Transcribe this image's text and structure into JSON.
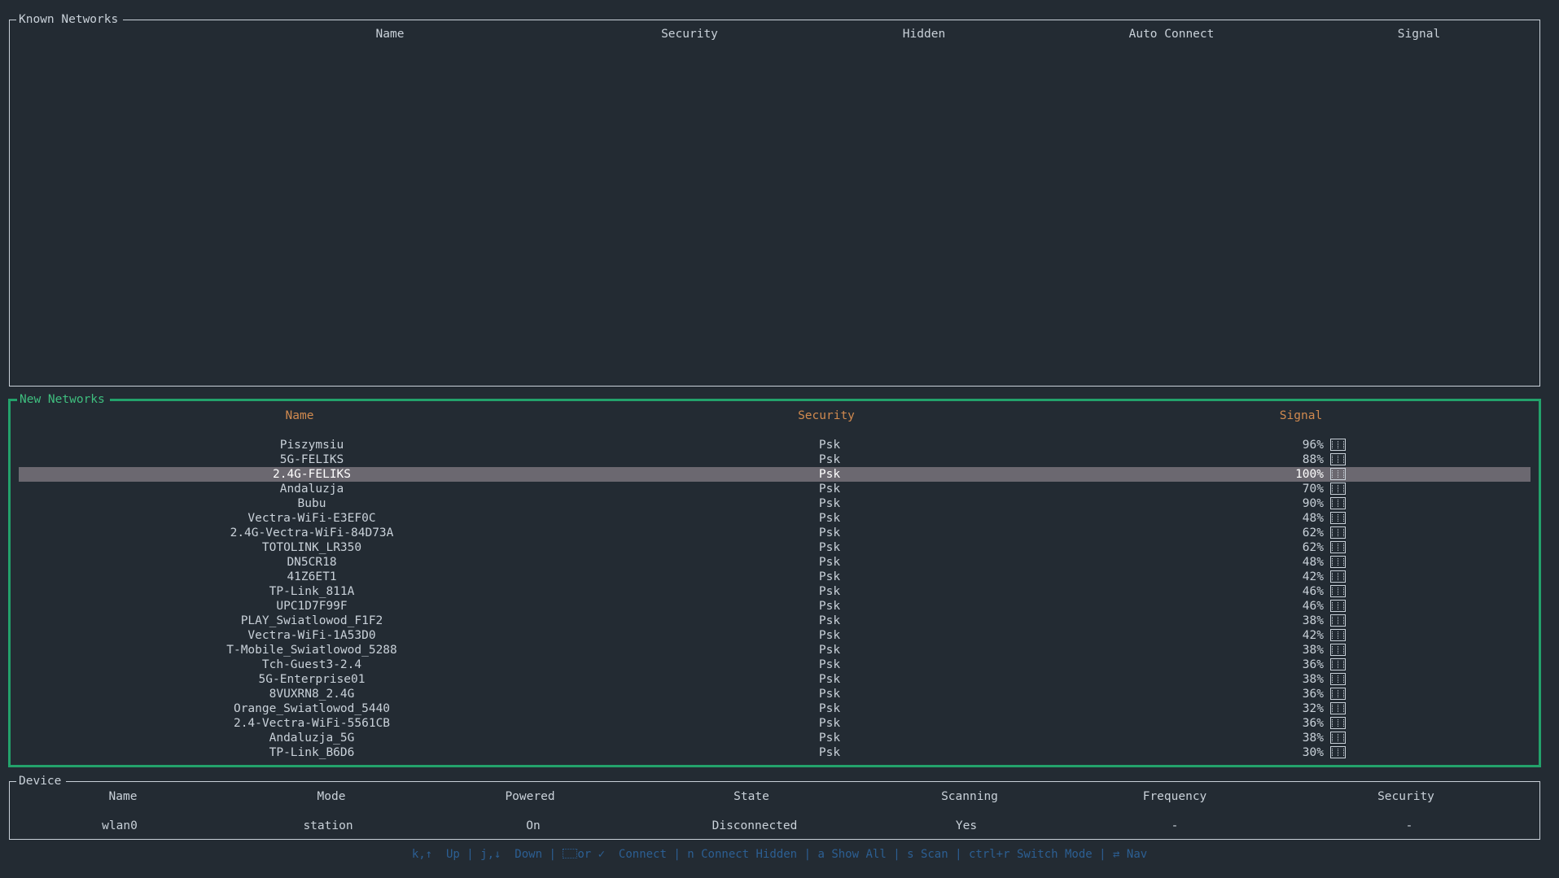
{
  "known_networks": {
    "title": "Known Networks",
    "columns": [
      "Name",
      "Security",
      "Hidden",
      "Auto Connect",
      "Signal"
    ],
    "rows": []
  },
  "new_networks": {
    "title": "New Networks",
    "columns": [
      "Name",
      "Security",
      "Signal"
    ],
    "selected_index": 2,
    "rows": [
      {
        "name": "Piszymsiu",
        "security": "Psk",
        "signal": "96%"
      },
      {
        "name": "5G-FELIKS",
        "security": "Psk",
        "signal": "88%"
      },
      {
        "name": "2.4G-FELIKS",
        "security": "Psk",
        "signal": "100%"
      },
      {
        "name": "Andaluzja",
        "security": "Psk",
        "signal": "70%"
      },
      {
        "name": "Bubu",
        "security": "Psk",
        "signal": "90%"
      },
      {
        "name": "Vectra-WiFi-E3EF0C",
        "security": "Psk",
        "signal": "48%"
      },
      {
        "name": "2.4G-Vectra-WiFi-84D73A",
        "security": "Psk",
        "signal": "62%"
      },
      {
        "name": "TOTOLINK_LR350",
        "security": "Psk",
        "signal": "62%"
      },
      {
        "name": "DN5CR18",
        "security": "Psk",
        "signal": "48%"
      },
      {
        "name": "41Z6ET1",
        "security": "Psk",
        "signal": "42%"
      },
      {
        "name": "TP-Link_811A",
        "security": "Psk",
        "signal": "46%"
      },
      {
        "name": "UPC1D7F99F",
        "security": "Psk",
        "signal": "46%"
      },
      {
        "name": "PLAY_Swiatlowod_F1F2",
        "security": "Psk",
        "signal": "38%"
      },
      {
        "name": "Vectra-WiFi-1A53D0",
        "security": "Psk",
        "signal": "42%"
      },
      {
        "name": "T-Mobile_Swiatlowod_5288",
        "security": "Psk",
        "signal": "38%"
      },
      {
        "name": "Tch-Guest3-2.4",
        "security": "Psk",
        "signal": "36%"
      },
      {
        "name": "5G-Enterprise01",
        "security": "Psk",
        "signal": "38%"
      },
      {
        "name": "8VUXRN8_2.4G",
        "security": "Psk",
        "signal": "36%"
      },
      {
        "name": "Orange_Swiatlowod_5440",
        "security": "Psk",
        "signal": "32%"
      },
      {
        "name": "2.4-Vectra-WiFi-5561CB",
        "security": "Psk",
        "signal": "36%"
      },
      {
        "name": "Andaluzja_5G",
        "security": "Psk",
        "signal": "38%"
      },
      {
        "name": "TP-Link_B6D6",
        "security": "Psk",
        "signal": "30%"
      }
    ]
  },
  "device": {
    "title": "Device",
    "columns": [
      "Name",
      "Mode",
      "Powered",
      "State",
      "Scanning",
      "Frequency",
      "Security"
    ],
    "values": [
      "wlan0",
      "station",
      "On",
      "Disconnected",
      "Yes",
      "-",
      "-"
    ]
  },
  "footer": {
    "up_key": "k,↑",
    "up_label": "Up",
    "down_key": "j,↓",
    "down_label": "Down",
    "connect_key_suffix": "or ✓",
    "connect_label": "Connect",
    "hidden_key": "n",
    "hidden_label": "Connect Hidden",
    "showall_key": "a",
    "showall_label": "Show All",
    "scan_key": "s",
    "scan_label": "Scan",
    "mode_key": "ctrl+r",
    "mode_label": "Switch Mode",
    "nav_key": "⇄",
    "nav_label": "Nav",
    "separator": "|"
  },
  "colors": {
    "background": "#232b33",
    "border": "#c9d1d9",
    "active_border": "#23a26b",
    "header_orange": "#d18a4f",
    "selection": "#6b6870",
    "footer_blue": "#2c5f93"
  }
}
